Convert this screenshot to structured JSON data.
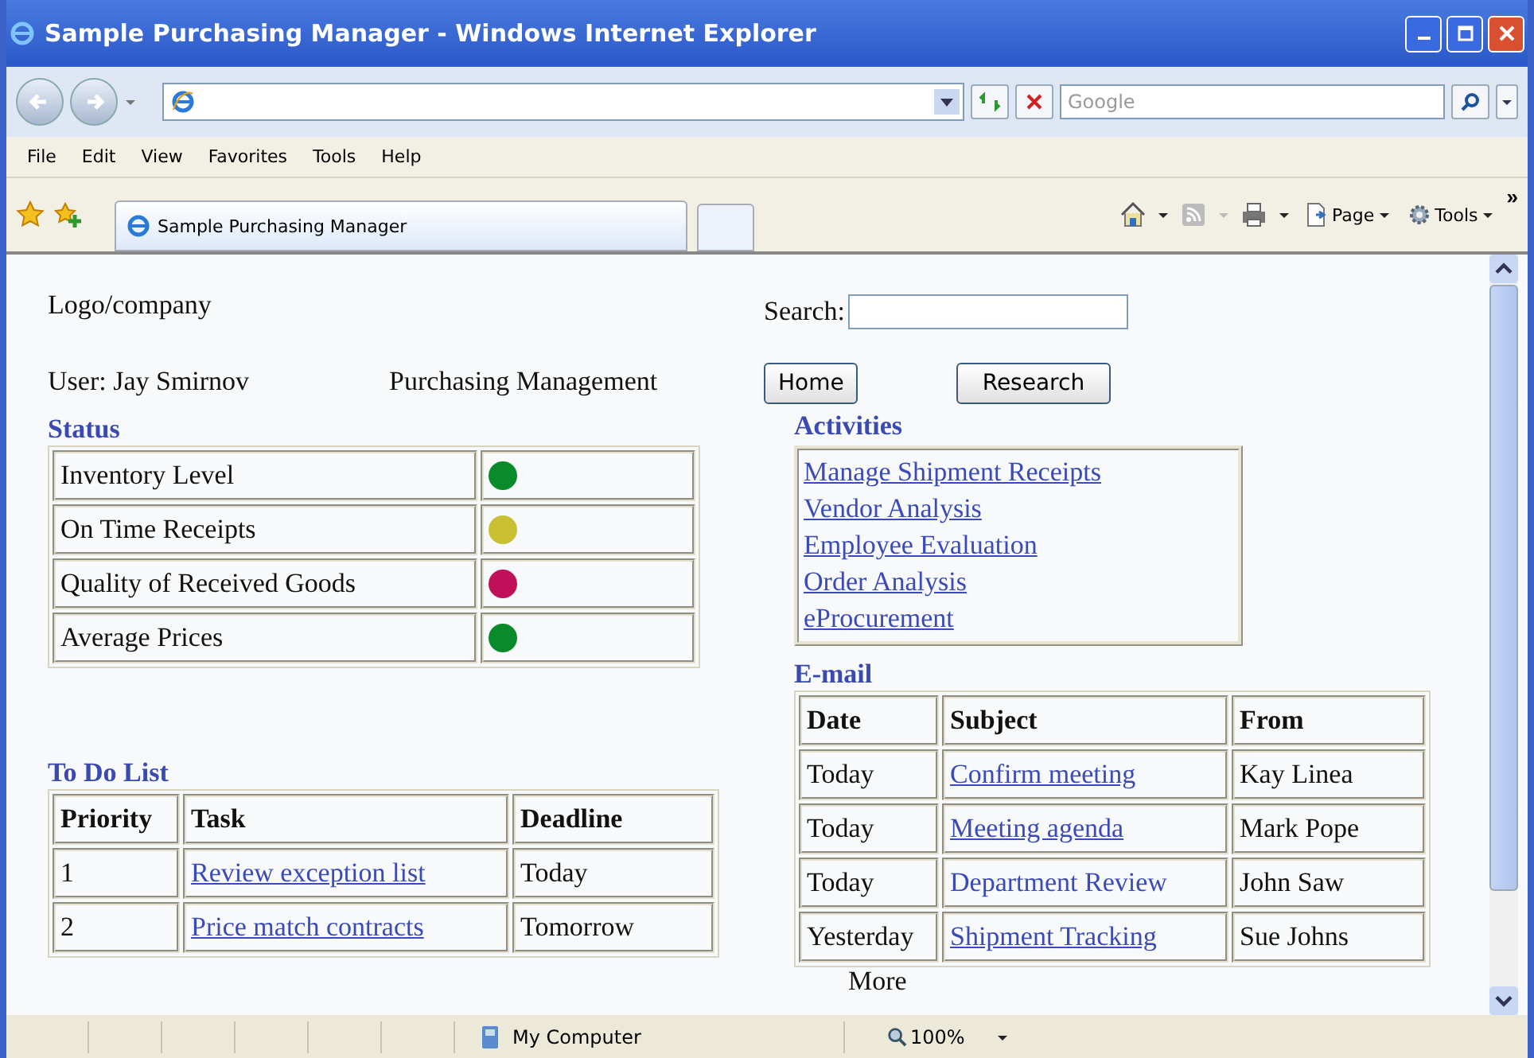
{
  "window": {
    "title": "Sample Purchasing Manager - Windows Internet Explorer"
  },
  "address_bar": {
    "search_placeholder": "Google"
  },
  "menu": [
    "File",
    "Edit",
    "View",
    "Favorites",
    "Tools",
    "Help"
  ],
  "tabs": [
    {
      "label": "Sample Purchasing Manager",
      "selected": true
    }
  ],
  "toolbar": {
    "page": "Page",
    "tools": "Tools",
    "overflow": "»"
  },
  "page": {
    "logo": "Logo/company",
    "search_label": "Search:",
    "user": "User: Jay Smirnov",
    "app_title": "Purchasing Management",
    "buttons": [
      "Home",
      "Research"
    ],
    "status": {
      "title": "Status",
      "rows": [
        {
          "label": "Inventory Level",
          "color": "#0a8a2a"
        },
        {
          "label": "On Time Receipts",
          "color": "#c8c030"
        },
        {
          "label": "Quality of Received Goods",
          "color": "#c0105a"
        },
        {
          "label": "Average Prices",
          "color": "#0a8a2a"
        }
      ]
    },
    "activities": {
      "title": "Activities",
      "links": [
        "Manage Shipment Receipts",
        "Vendor Analysis",
        "Employee Evaluation",
        "Order Analysis",
        "eProcurement"
      ]
    },
    "email": {
      "title": "E-mail",
      "columns": [
        "Date",
        "Subject",
        "From"
      ],
      "rows": [
        {
          "date": "Today",
          "subject": "Confirm meeting",
          "from": "Kay Linea",
          "underlined": true
        },
        {
          "date": "Today",
          "subject": "Meeting agenda",
          "from": "Mark Pope",
          "underlined": true
        },
        {
          "date": "Today",
          "subject": "Department Review",
          "from": "John Saw",
          "underlined": false
        },
        {
          "date": "Yesterday",
          "subject": "Shipment Tracking",
          "from": "Sue Johns",
          "underlined": true
        }
      ]
    },
    "more": "More",
    "todo": {
      "title": "To Do List",
      "columns": [
        "Priority",
        "Task",
        "Deadline"
      ],
      "rows": [
        {
          "priority": "1",
          "task": "Review exception list",
          "deadline": "Today"
        },
        {
          "priority": "2",
          "task": "Price match contracts",
          "deadline": "Tomorrow"
        }
      ]
    }
  },
  "status_bar": {
    "zone": "My Computer",
    "zoom": "100%"
  }
}
